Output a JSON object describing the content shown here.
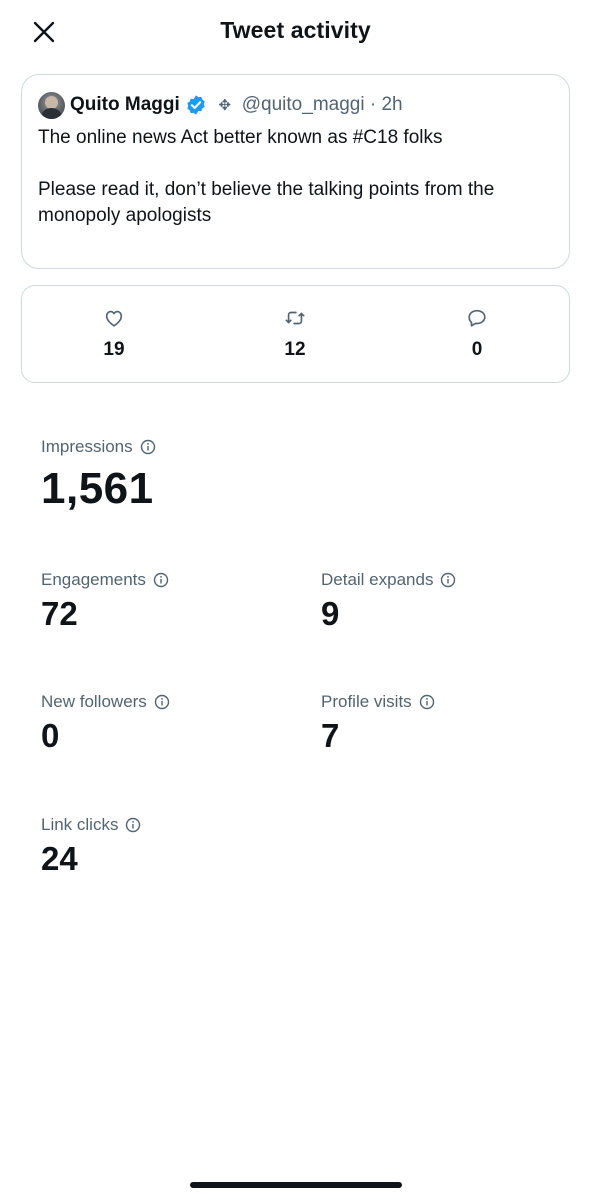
{
  "header": {
    "title": "Tweet activity",
    "close_icon": "close-icon"
  },
  "tweet": {
    "author_name": "Quito Maggi",
    "verified_icon": "verified-badge-icon",
    "emblem_icon": "emblem-icon",
    "handle_time": "@quito_maggi · 2h",
    "text": "The online news Act better known as #C18 folks\n\nPlease read it, don’t believe the talking points from the monopoly apologists"
  },
  "stats": [
    {
      "icon": "heart-icon",
      "value": "19"
    },
    {
      "icon": "retweet-icon",
      "value": "12"
    },
    {
      "icon": "reply-icon",
      "value": "0"
    }
  ],
  "metrics": {
    "impressions": {
      "label": "Impressions",
      "value": "1,561"
    },
    "engagements": {
      "label": "Engagements",
      "value": "72"
    },
    "detail_expands": {
      "label": "Detail expands",
      "value": "9"
    },
    "new_followers": {
      "label": "New followers",
      "value": "0"
    },
    "profile_visits": {
      "label": "Profile visits",
      "value": "7"
    },
    "link_clicks": {
      "label": "Link clicks",
      "value": "24"
    }
  },
  "colors": {
    "text": "#0f1419",
    "secondary": "#536471",
    "border": "#cfd9de",
    "verified": "#1d9bf0"
  }
}
